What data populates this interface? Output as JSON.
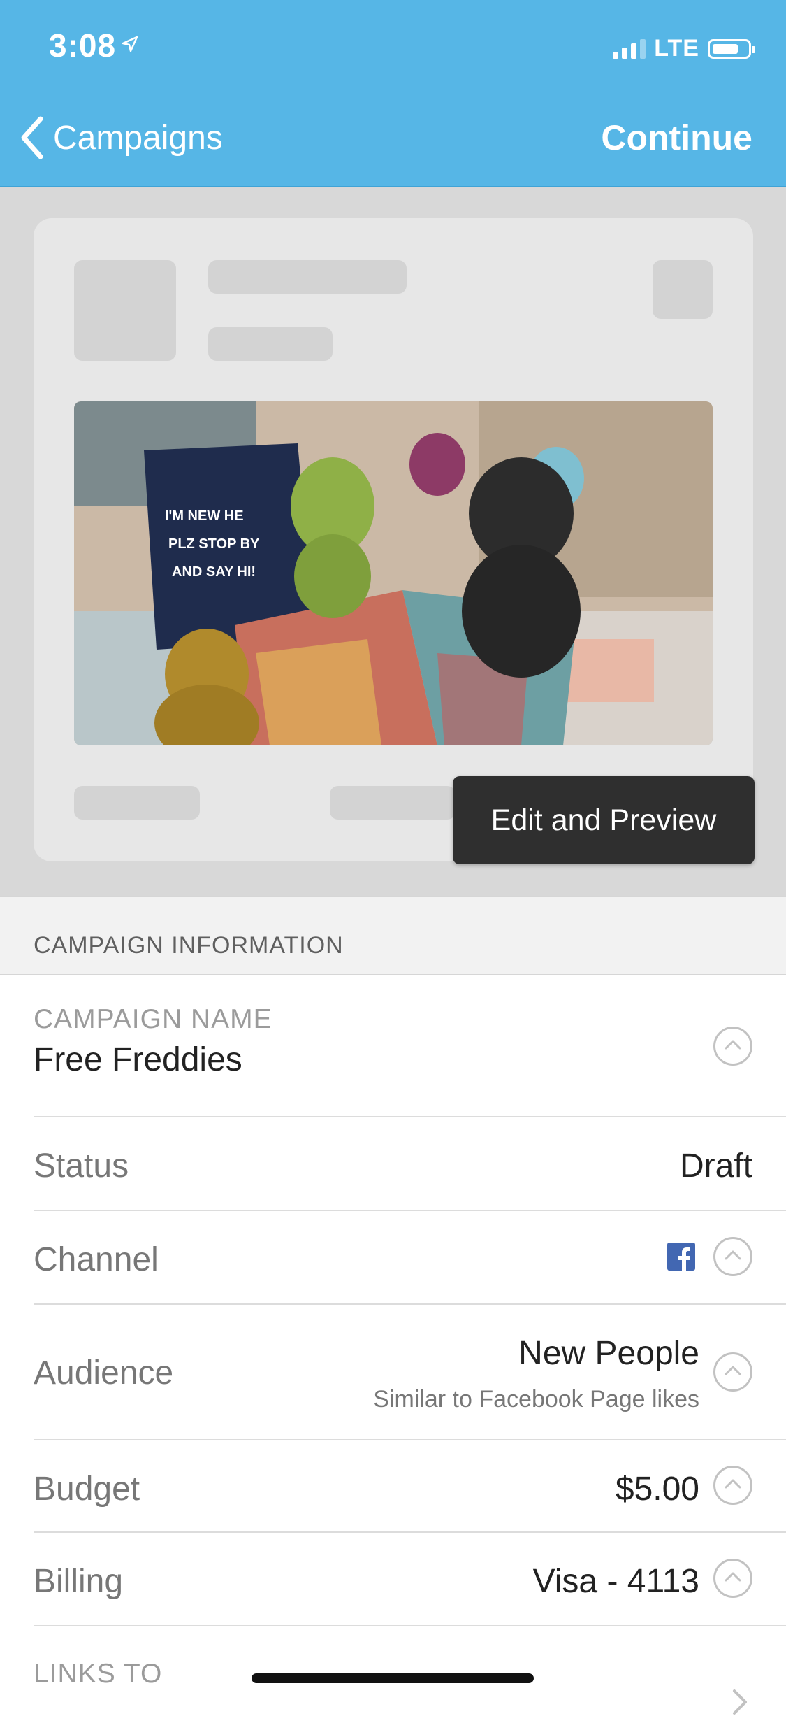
{
  "status_bar": {
    "time": "3:08",
    "network": "LTE"
  },
  "nav": {
    "back_label": "Campaigns",
    "continue_label": "Continue"
  },
  "preview": {
    "edit_button": "Edit and Preview",
    "photo_sign_text": [
      "I'M NEW HE",
      "PLZ STOP BY",
      "AND SAY HI!"
    ]
  },
  "section": {
    "title": "CAMPAIGN INFORMATION"
  },
  "campaign": {
    "name_label": "CAMPAIGN NAME",
    "name_value": "Free Freddies",
    "rows": {
      "status": {
        "label": "Status",
        "value": "Draft"
      },
      "channel": {
        "label": "Channel",
        "icon": "facebook-icon"
      },
      "audience": {
        "label": "Audience",
        "value": "New People",
        "sub": "Similar to Facebook Page likes"
      },
      "budget": {
        "label": "Budget",
        "value": "$5.00"
      },
      "billing": {
        "label": "Billing",
        "value": "Visa - 4113"
      },
      "links": {
        "label": "LINKS TO"
      }
    }
  },
  "colors": {
    "nav_blue": "#56b6e6",
    "facebook_blue": "#4267b2"
  }
}
